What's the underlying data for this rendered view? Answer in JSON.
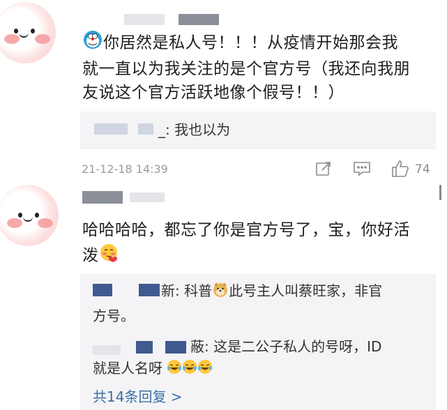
{
  "comments": [
    {
      "text_line1": "你居然是私人号！！！从疫情开始那会我",
      "text_line2": "就一直以为我关注的是个官方号（我还向我朋",
      "text_line3": "友说这个官方活跃地像个假号！！）",
      "reply_suffix": "_: 我也以为",
      "time": "21-12-18 14:39",
      "like_count": "74"
    },
    {
      "text_line1": "哈哈哈哈，都忘了你是官方号了，宝，你好活",
      "text_line2": "泼",
      "reply1_prefix": "新: 科普",
      "reply1_tail": "此号主人叫蔡旺家，非官",
      "reply1_line2": "方号。",
      "reply2_prefix": "蔽: 这是二公子私人的号呀，ID",
      "reply2_line2": "就是人名呀",
      "more_replies": "共14条回复 >"
    }
  ],
  "icons": [
    "doraemon-icon",
    "share-icon",
    "comment-icon",
    "like-icon",
    "blush-emoji",
    "doge-emoji",
    "laugh-cry-emoji"
  ]
}
